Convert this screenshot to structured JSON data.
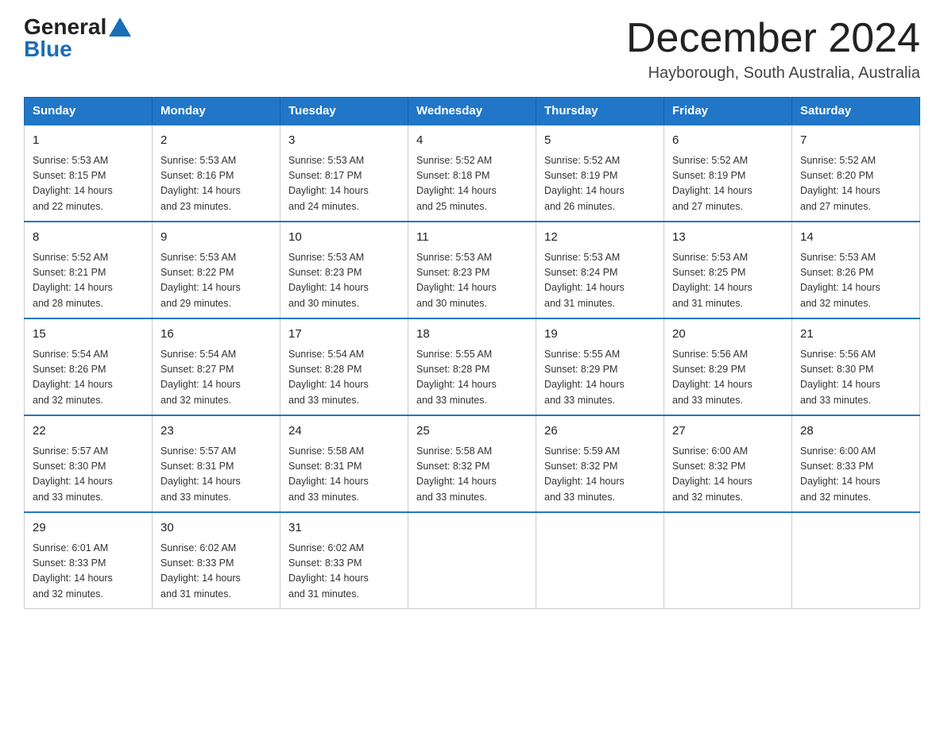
{
  "logo": {
    "general": "General",
    "blue": "Blue"
  },
  "title": "December 2024",
  "location": "Hayborough, South Australia, Australia",
  "days_of_week": [
    "Sunday",
    "Monday",
    "Tuesday",
    "Wednesday",
    "Thursday",
    "Friday",
    "Saturday"
  ],
  "weeks": [
    [
      {
        "day": "1",
        "sunrise": "5:53 AM",
        "sunset": "8:15 PM",
        "daylight": "14 hours and 22 minutes."
      },
      {
        "day": "2",
        "sunrise": "5:53 AM",
        "sunset": "8:16 PM",
        "daylight": "14 hours and 23 minutes."
      },
      {
        "day": "3",
        "sunrise": "5:53 AM",
        "sunset": "8:17 PM",
        "daylight": "14 hours and 24 minutes."
      },
      {
        "day": "4",
        "sunrise": "5:52 AM",
        "sunset": "8:18 PM",
        "daylight": "14 hours and 25 minutes."
      },
      {
        "day": "5",
        "sunrise": "5:52 AM",
        "sunset": "8:19 PM",
        "daylight": "14 hours and 26 minutes."
      },
      {
        "day": "6",
        "sunrise": "5:52 AM",
        "sunset": "8:19 PM",
        "daylight": "14 hours and 27 minutes."
      },
      {
        "day": "7",
        "sunrise": "5:52 AM",
        "sunset": "8:20 PM",
        "daylight": "14 hours and 27 minutes."
      }
    ],
    [
      {
        "day": "8",
        "sunrise": "5:52 AM",
        "sunset": "8:21 PM",
        "daylight": "14 hours and 28 minutes."
      },
      {
        "day": "9",
        "sunrise": "5:53 AM",
        "sunset": "8:22 PM",
        "daylight": "14 hours and 29 minutes."
      },
      {
        "day": "10",
        "sunrise": "5:53 AM",
        "sunset": "8:23 PM",
        "daylight": "14 hours and 30 minutes."
      },
      {
        "day": "11",
        "sunrise": "5:53 AM",
        "sunset": "8:23 PM",
        "daylight": "14 hours and 30 minutes."
      },
      {
        "day": "12",
        "sunrise": "5:53 AM",
        "sunset": "8:24 PM",
        "daylight": "14 hours and 31 minutes."
      },
      {
        "day": "13",
        "sunrise": "5:53 AM",
        "sunset": "8:25 PM",
        "daylight": "14 hours and 31 minutes."
      },
      {
        "day": "14",
        "sunrise": "5:53 AM",
        "sunset": "8:26 PM",
        "daylight": "14 hours and 32 minutes."
      }
    ],
    [
      {
        "day": "15",
        "sunrise": "5:54 AM",
        "sunset": "8:26 PM",
        "daylight": "14 hours and 32 minutes."
      },
      {
        "day": "16",
        "sunrise": "5:54 AM",
        "sunset": "8:27 PM",
        "daylight": "14 hours and 32 minutes."
      },
      {
        "day": "17",
        "sunrise": "5:54 AM",
        "sunset": "8:28 PM",
        "daylight": "14 hours and 33 minutes."
      },
      {
        "day": "18",
        "sunrise": "5:55 AM",
        "sunset": "8:28 PM",
        "daylight": "14 hours and 33 minutes."
      },
      {
        "day": "19",
        "sunrise": "5:55 AM",
        "sunset": "8:29 PM",
        "daylight": "14 hours and 33 minutes."
      },
      {
        "day": "20",
        "sunrise": "5:56 AM",
        "sunset": "8:29 PM",
        "daylight": "14 hours and 33 minutes."
      },
      {
        "day": "21",
        "sunrise": "5:56 AM",
        "sunset": "8:30 PM",
        "daylight": "14 hours and 33 minutes."
      }
    ],
    [
      {
        "day": "22",
        "sunrise": "5:57 AM",
        "sunset": "8:30 PM",
        "daylight": "14 hours and 33 minutes."
      },
      {
        "day": "23",
        "sunrise": "5:57 AM",
        "sunset": "8:31 PM",
        "daylight": "14 hours and 33 minutes."
      },
      {
        "day": "24",
        "sunrise": "5:58 AM",
        "sunset": "8:31 PM",
        "daylight": "14 hours and 33 minutes."
      },
      {
        "day": "25",
        "sunrise": "5:58 AM",
        "sunset": "8:32 PM",
        "daylight": "14 hours and 33 minutes."
      },
      {
        "day": "26",
        "sunrise": "5:59 AM",
        "sunset": "8:32 PM",
        "daylight": "14 hours and 33 minutes."
      },
      {
        "day": "27",
        "sunrise": "6:00 AM",
        "sunset": "8:32 PM",
        "daylight": "14 hours and 32 minutes."
      },
      {
        "day": "28",
        "sunrise": "6:00 AM",
        "sunset": "8:33 PM",
        "daylight": "14 hours and 32 minutes."
      }
    ],
    [
      {
        "day": "29",
        "sunrise": "6:01 AM",
        "sunset": "8:33 PM",
        "daylight": "14 hours and 32 minutes."
      },
      {
        "day": "30",
        "sunrise": "6:02 AM",
        "sunset": "8:33 PM",
        "daylight": "14 hours and 31 minutes."
      },
      {
        "day": "31",
        "sunrise": "6:02 AM",
        "sunset": "8:33 PM",
        "daylight": "14 hours and 31 minutes."
      },
      null,
      null,
      null,
      null
    ]
  ],
  "labels": {
    "sunrise": "Sunrise:",
    "sunset": "Sunset:",
    "daylight": "Daylight:"
  }
}
